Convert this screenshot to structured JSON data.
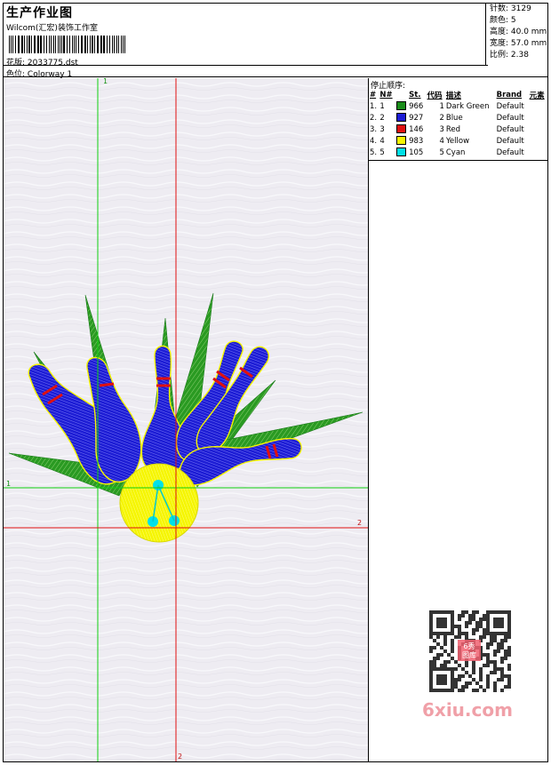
{
  "header": {
    "title": "生产作业图",
    "company": "Wilcom(汇宏)装饰工作室",
    "design_label": "花版:",
    "design_value": "2033775.dst",
    "colorway_label": "色位:",
    "colorway_value": "Colorway 1"
  },
  "specs": {
    "stitches": "针数: 3129",
    "colors": "颜色: 5",
    "height": "高度: 40.0 mm",
    "width": "宽度: 57.0 mm",
    "scale": "比例: 2.38"
  },
  "stop_sequence": {
    "heading": "停止顺序:",
    "columns": [
      "#",
      "N#",
      "St.",
      "代码",
      "描述",
      "Brand",
      "元素"
    ],
    "rows": [
      {
        "idx": "1.",
        "n": "1",
        "color": "#1a8c1a",
        "st": "966",
        "code": "1",
        "desc": "Dark Green",
        "brand": "Default"
      },
      {
        "idx": "2.",
        "n": "2",
        "color": "#1c1cd4",
        "st": "927",
        "code": "2",
        "desc": "Blue",
        "brand": "Default"
      },
      {
        "idx": "3.",
        "n": "3",
        "color": "#e01010",
        "st": "146",
        "code": "3",
        "desc": "Red",
        "brand": "Default"
      },
      {
        "idx": "4.",
        "n": "4",
        "color": "#f5f500",
        "st": "983",
        "code": "4",
        "desc": "Yellow",
        "brand": "Default"
      },
      {
        "idx": "5.",
        "n": "5",
        "color": "#00e0e8",
        "st": "105",
        "code": "5",
        "desc": "Cyan",
        "brand": "Default"
      }
    ]
  },
  "guides": {
    "green_label": "1",
    "red_label": "2",
    "green_color": "#10d010",
    "red_color": "#e01010"
  },
  "watermark": {
    "text": "6xiu.com",
    "seal_lines": [
      "6秀",
      "图库"
    ]
  }
}
